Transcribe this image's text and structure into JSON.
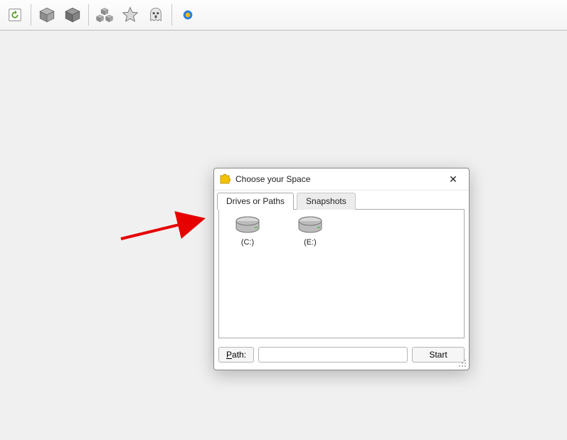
{
  "dialog": {
    "title": "Choose your Space",
    "tabs": {
      "drives": "Drives or Paths",
      "snapshots": "Snapshots"
    },
    "drives": [
      {
        "label": "(C:)"
      },
      {
        "label": "(E:)"
      }
    ],
    "path_button": "Path:",
    "path_value": "",
    "start_button": "Start",
    "close_glyph": "✕"
  }
}
